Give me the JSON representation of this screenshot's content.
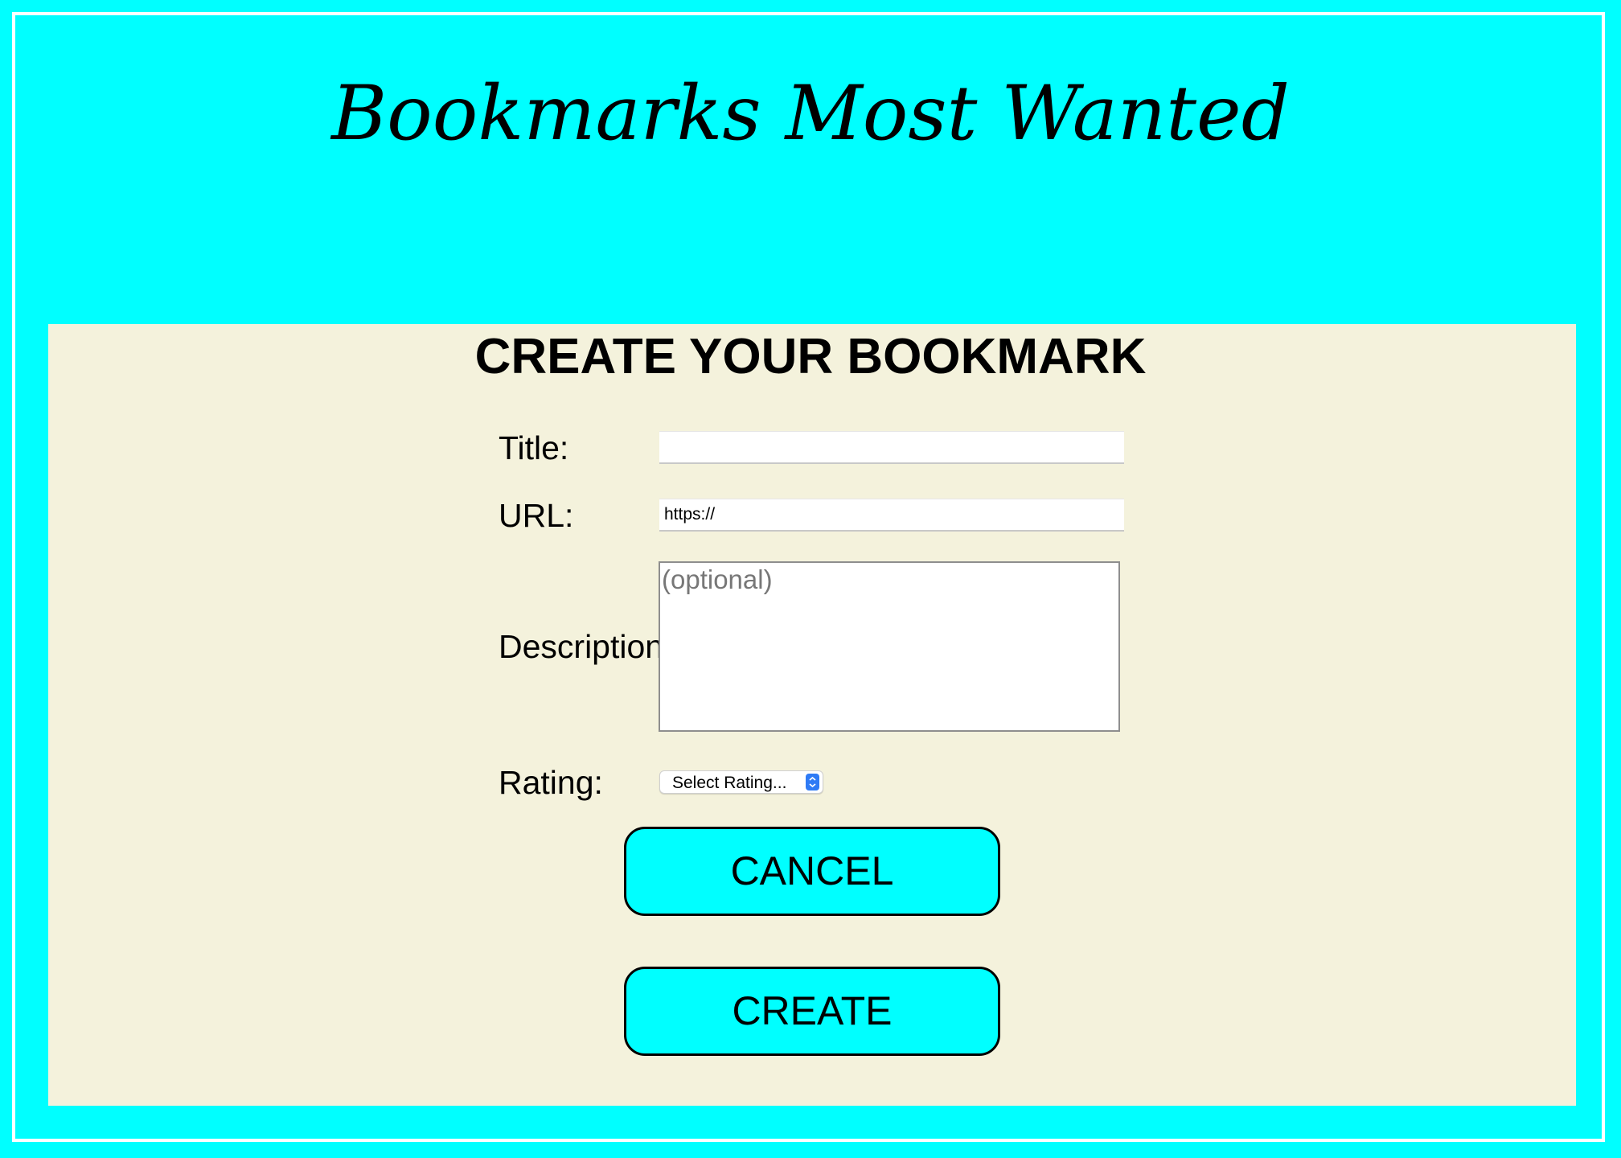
{
  "header": {
    "site_title": "Bookmarks Most Wanted"
  },
  "form": {
    "heading": "CREATE YOUR BOOKMARK",
    "title_label": "Title:",
    "title_value": "",
    "url_label": "URL:",
    "url_value": "https://",
    "description_label": "Description:",
    "description_placeholder": "(optional)",
    "rating_label": "Rating:",
    "rating_selected": "Select Rating...",
    "cancel_label": "CANCEL",
    "create_label": "CREATE"
  },
  "colors": {
    "background": "#00ffff",
    "panel": "#f4f2dc",
    "button": "#00ffff",
    "select_accent": "#2f7bf5"
  }
}
